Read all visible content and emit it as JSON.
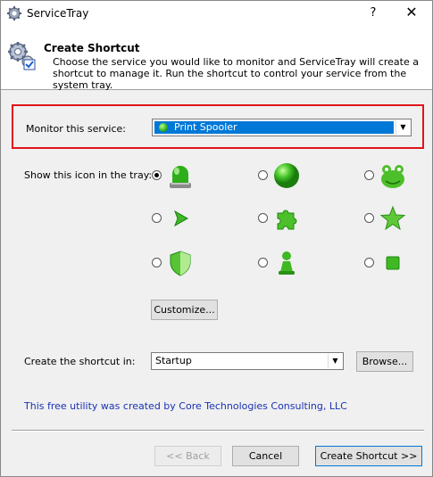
{
  "window": {
    "title": "ServiceTray",
    "help_symbol": "?",
    "close_symbol": "✕"
  },
  "header": {
    "title": "Create Shortcut",
    "description": "Choose the service you would like to monitor and ServiceTray will create a shortcut to manage it. Run the shortcut to control your service from the system tray."
  },
  "monitor": {
    "label": "Monitor this service:",
    "selected": "Print Spooler"
  },
  "tray": {
    "label": "Show this icon in the tray:",
    "selected_index": 0,
    "icons": [
      "beacon-light-icon",
      "green-ball-icon",
      "green-frog-icon",
      "play-arrow-icon",
      "puzzle-piece-icon",
      "green-star-icon",
      "green-shield-icon",
      "game-pawn-icon",
      "green-square-icon"
    ]
  },
  "customize_label": "Customize...",
  "location": {
    "label": "Create the shortcut in:",
    "value": "Startup",
    "browse_label": "Browse..."
  },
  "credit": "This free utility was created by Core Technologies Consulting, LLC",
  "footer": {
    "back_label": "<< Back",
    "cancel_label": "Cancel",
    "create_label": "Create Shortcut >>"
  },
  "colors": {
    "accent": "#0078d7",
    "highlight_frame": "#e0141e",
    "icon_green": "#2fae1c",
    "link_blue": "#1a32b4"
  }
}
